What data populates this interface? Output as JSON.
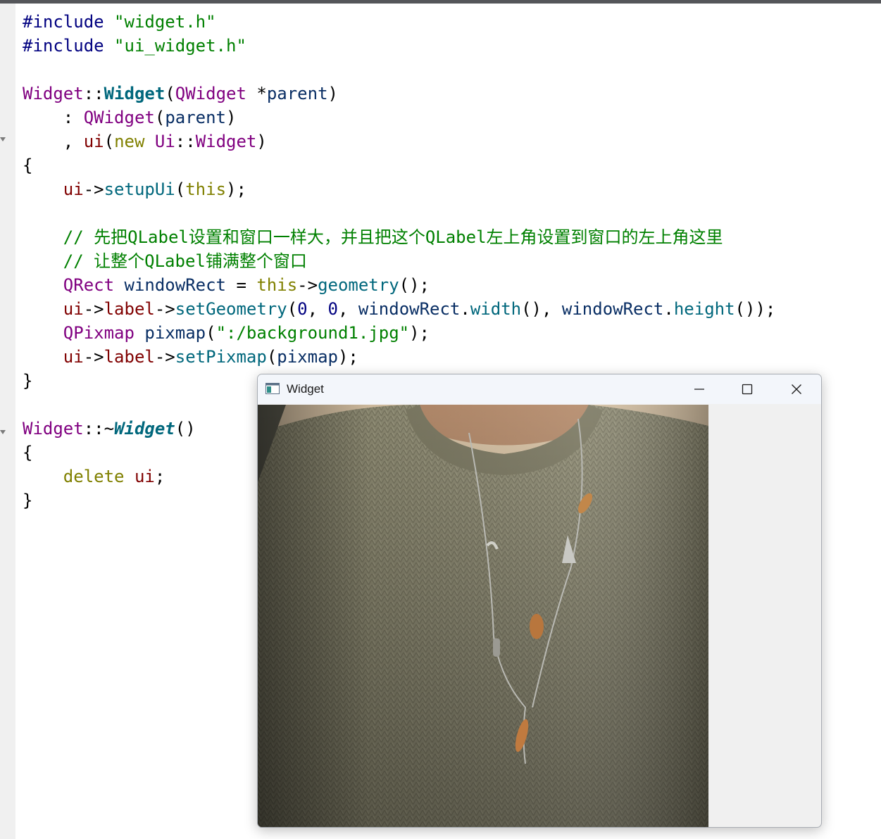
{
  "editor": {
    "lines": [
      {
        "tokens": [
          {
            "c": "pp",
            "t": "#include "
          },
          {
            "c": "str",
            "t": "\"widget.h\""
          }
        ]
      },
      {
        "tokens": [
          {
            "c": "pp",
            "t": "#include "
          },
          {
            "c": "str",
            "t": "\"ui_widget.h\""
          }
        ]
      },
      {
        "tokens": []
      },
      {
        "tokens": [
          {
            "c": "cls",
            "t": "Widget"
          },
          {
            "c": "",
            "t": "::"
          },
          {
            "c": "fnd",
            "t": "Widget"
          },
          {
            "c": "",
            "t": "("
          },
          {
            "c": "cls",
            "t": "QWidget"
          },
          {
            "c": "",
            "t": " *"
          },
          {
            "c": "var",
            "t": "parent"
          },
          {
            "c": "",
            "t": ")"
          }
        ]
      },
      {
        "tokens": [
          {
            "c": "",
            "t": "    : "
          },
          {
            "c": "cls",
            "t": "QWidget"
          },
          {
            "c": "",
            "t": "("
          },
          {
            "c": "var",
            "t": "parent"
          },
          {
            "c": "",
            "t": ")"
          }
        ]
      },
      {
        "tokens": [
          {
            "c": "",
            "t": "    , "
          },
          {
            "c": "mem",
            "t": "ui"
          },
          {
            "c": "",
            "t": "("
          },
          {
            "c": "kw",
            "t": "new"
          },
          {
            "c": "",
            "t": " "
          },
          {
            "c": "cls",
            "t": "Ui"
          },
          {
            "c": "",
            "t": "::"
          },
          {
            "c": "cls",
            "t": "Widget"
          },
          {
            "c": "",
            "t": ")"
          }
        ]
      },
      {
        "tokens": [
          {
            "c": "",
            "t": "{"
          }
        ]
      },
      {
        "tokens": [
          {
            "c": "",
            "t": "    "
          },
          {
            "c": "mem",
            "t": "ui"
          },
          {
            "c": "",
            "t": "->"
          },
          {
            "c": "fn",
            "t": "setupUi"
          },
          {
            "c": "",
            "t": "("
          },
          {
            "c": "kw",
            "t": "this"
          },
          {
            "c": "",
            "t": ");"
          }
        ]
      },
      {
        "tokens": []
      },
      {
        "tokens": [
          {
            "c": "cmt",
            "t": "    // 先把QLabel设置和窗口一样大，并且把这个QLabel左上角设置到窗口的左上角这里"
          }
        ]
      },
      {
        "tokens": [
          {
            "c": "cmt",
            "t": "    // 让整个QLabel铺满整个窗口"
          }
        ]
      },
      {
        "tokens": [
          {
            "c": "",
            "t": "    "
          },
          {
            "c": "cls",
            "t": "QRect"
          },
          {
            "c": "",
            "t": " "
          },
          {
            "c": "var",
            "t": "windowRect"
          },
          {
            "c": "",
            "t": " = "
          },
          {
            "c": "kw",
            "t": "this"
          },
          {
            "c": "",
            "t": "->"
          },
          {
            "c": "fn",
            "t": "geometry"
          },
          {
            "c": "",
            "t": "();"
          }
        ]
      },
      {
        "tokens": [
          {
            "c": "",
            "t": "    "
          },
          {
            "c": "mem",
            "t": "ui"
          },
          {
            "c": "",
            "t": "->"
          },
          {
            "c": "mem",
            "t": "label"
          },
          {
            "c": "",
            "t": "->"
          },
          {
            "c": "fn",
            "t": "setGeometry"
          },
          {
            "c": "",
            "t": "("
          },
          {
            "c": "num",
            "t": "0"
          },
          {
            "c": "",
            "t": ", "
          },
          {
            "c": "num",
            "t": "0"
          },
          {
            "c": "",
            "t": ", "
          },
          {
            "c": "var",
            "t": "windowRect"
          },
          {
            "c": "",
            "t": "."
          },
          {
            "c": "fn",
            "t": "width"
          },
          {
            "c": "",
            "t": "(), "
          },
          {
            "c": "var",
            "t": "windowRect"
          },
          {
            "c": "",
            "t": "."
          },
          {
            "c": "fn",
            "t": "height"
          },
          {
            "c": "",
            "t": "());"
          }
        ]
      },
      {
        "tokens": [
          {
            "c": "",
            "t": "    "
          },
          {
            "c": "cls",
            "t": "QPixmap"
          },
          {
            "c": "",
            "t": " "
          },
          {
            "c": "var",
            "t": "pixmap"
          },
          {
            "c": "",
            "t": "("
          },
          {
            "c": "str",
            "t": "\":/background1.jpg\""
          },
          {
            "c": "",
            "t": ");"
          }
        ]
      },
      {
        "tokens": [
          {
            "c": "",
            "t": "    "
          },
          {
            "c": "mem",
            "t": "ui"
          },
          {
            "c": "",
            "t": "->"
          },
          {
            "c": "mem",
            "t": "label"
          },
          {
            "c": "",
            "t": "->"
          },
          {
            "c": "fn",
            "t": "setPixmap"
          },
          {
            "c": "",
            "t": "("
          },
          {
            "c": "var",
            "t": "pixmap"
          },
          {
            "c": "",
            "t": ");"
          }
        ]
      },
      {
        "tokens": [
          {
            "c": "",
            "t": "}"
          }
        ]
      },
      {
        "tokens": []
      },
      {
        "tokens": [
          {
            "c": "cls",
            "t": "Widget"
          },
          {
            "c": "",
            "t": "::~"
          },
          {
            "c": "fni",
            "t": "Widget"
          },
          {
            "c": "",
            "t": "()"
          }
        ]
      },
      {
        "tokens": [
          {
            "c": "",
            "t": "{"
          }
        ]
      },
      {
        "tokens": [
          {
            "c": "",
            "t": "    "
          },
          {
            "c": "kw",
            "t": "delete"
          },
          {
            "c": "",
            "t": " "
          },
          {
            "c": "mem",
            "t": "ui"
          },
          {
            "c": "",
            "t": ";"
          }
        ]
      },
      {
        "tokens": [
          {
            "c": "",
            "t": "}"
          }
        ]
      }
    ]
  },
  "window": {
    "title": "Widget",
    "icon": "app-window-icon",
    "buttons": [
      {
        "name": "minimize-button",
        "icon": "minimize-icon"
      },
      {
        "name": "maximize-button",
        "icon": "maximize-icon"
      },
      {
        "name": "close-button",
        "icon": "close-icon"
      }
    ]
  },
  "label_image": {
    "description_icon": "background-photo",
    "colors": {
      "sweater": "#8f8c74",
      "skin": "#b48a6a",
      "backdrop": "#d7c2a4"
    }
  }
}
